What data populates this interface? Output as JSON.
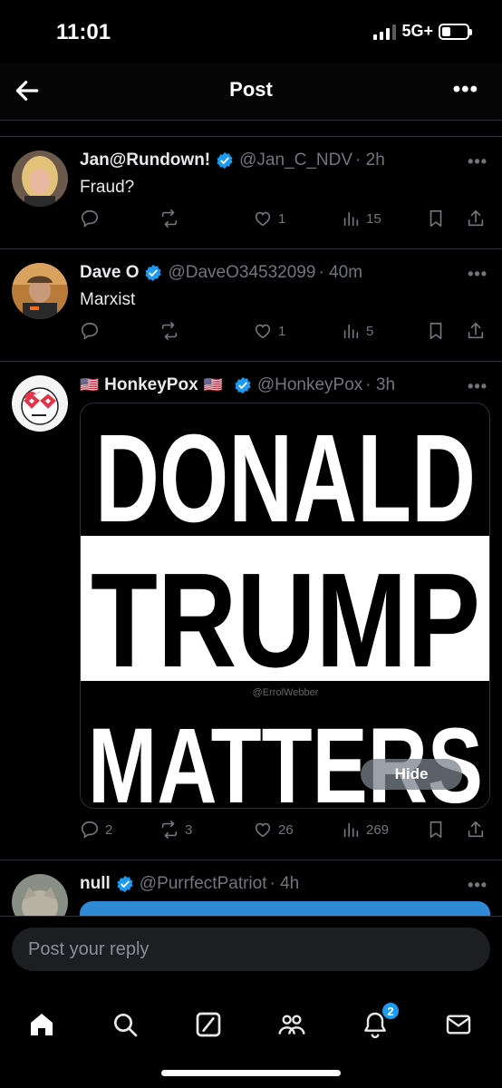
{
  "status": {
    "time": "11:01",
    "network": "5G+"
  },
  "topbar": {
    "title": "Post",
    "more": "•••"
  },
  "posts": [
    {
      "name": "Jan@Rundown!",
      "handle": "@Jan_C_NDV",
      "time": "· 2h",
      "text": "Fraud?",
      "more": "•••",
      "stats": {
        "replies": "",
        "reposts": "",
        "likes": "1",
        "views": "15"
      }
    },
    {
      "name": "Dave O",
      "handle": "@DaveO34532099",
      "time": "· 40m",
      "text": "Marxist",
      "more": "•••",
      "stats": {
        "replies": "",
        "reposts": "",
        "likes": "1",
        "views": "5"
      }
    },
    {
      "name": "HonkeyPox",
      "flag": "🇺🇸",
      "handle": "@HonkeyPox",
      "time": "· 3h",
      "more": "•••",
      "media": {
        "line1": "DONALD",
        "line2": "TRUMP",
        "line3": "MATTERS",
        "watermark": "@ErrolWebber",
        "hide_label": "Hide"
      },
      "stats": {
        "replies": "2",
        "reposts": "3",
        "likes": "26",
        "views": "269"
      }
    },
    {
      "name": "null",
      "handle": "@PurrfectPatriot",
      "time": "· 4h",
      "more": "•••"
    }
  ],
  "reply": {
    "placeholder": "Post your reply"
  },
  "nav": {
    "notifications_badge": "2"
  },
  "colors": {
    "accent": "#1d9bf0",
    "muted": "#71767b",
    "background": "#000000"
  }
}
